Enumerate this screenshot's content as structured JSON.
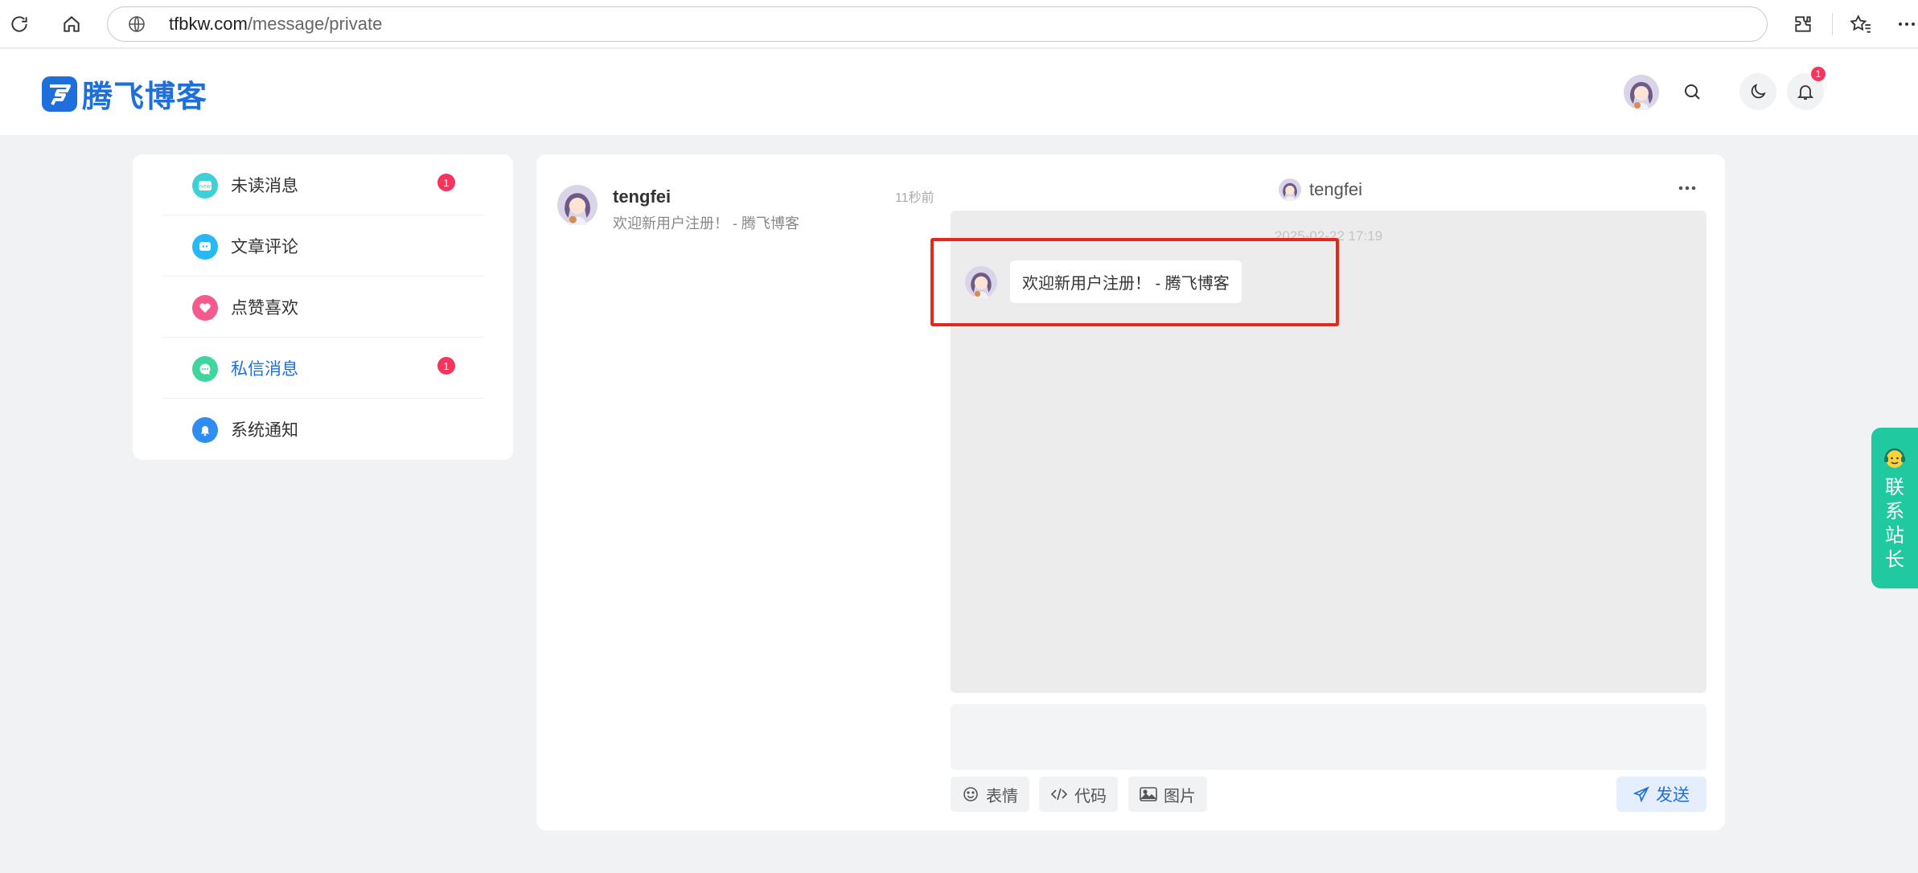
{
  "browser": {
    "url_domain": "tfbkw.com",
    "url_path": "/message/private"
  },
  "site": {
    "logo_text": "腾飞博客",
    "notification_count": "1",
    "accent_color": "#1e6fdc"
  },
  "sidebar": {
    "items": [
      {
        "label": "未读消息",
        "badge": "1",
        "icon": "unread-message-icon",
        "color": "#3fd0d6"
      },
      {
        "label": "文章评论",
        "badge": "",
        "icon": "comment-icon",
        "color": "#27b9f5"
      },
      {
        "label": "点赞喜欢",
        "badge": "",
        "icon": "heart-icon",
        "color": "#f55a8f"
      },
      {
        "label": "私信消息",
        "badge": "1",
        "icon": "private-message-icon",
        "color": "#3fd69e",
        "active": true
      },
      {
        "label": "系统通知",
        "badge": "",
        "icon": "bell-icon",
        "color": "#2f8cf5"
      }
    ]
  },
  "conversation": {
    "name": "tengfei",
    "preview": "欢迎新用户注册！ - 腾飞博客",
    "time": "11秒前"
  },
  "chat": {
    "header_name": "tengfei",
    "timestamp": "2025-02-22 17:19",
    "messages": [
      {
        "text": "欢迎新用户注册！ - 腾飞博客"
      }
    ],
    "reply_placeholder": ""
  },
  "toolbar": {
    "emoji_label": "表情",
    "code_label": "代码",
    "image_label": "图片",
    "send_label": "发送"
  },
  "contact_widget": {
    "label": "联系站长",
    "color": "#21c9a0"
  }
}
